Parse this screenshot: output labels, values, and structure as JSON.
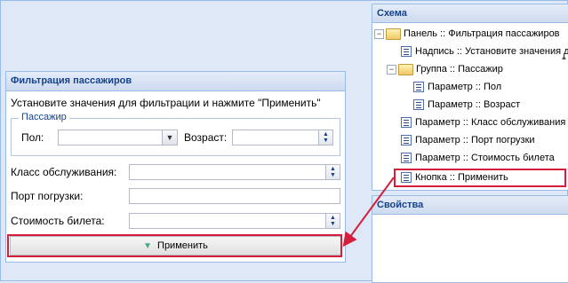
{
  "filter_panel": {
    "title": "Фильтрация пассажиров",
    "instruction": "Установите значения для фильтрации и нажмите \"Применить\"",
    "passenger_group": {
      "legend": "Пассажир",
      "gender_label": "Пол:",
      "gender_value": "",
      "age_label": "Возраст:",
      "age_value": ""
    },
    "class_label": "Класс обслуживания:",
    "class_value": "",
    "port_label": "Порт погрузки:",
    "port_value": "",
    "price_label": "Стоимость билета:",
    "price_value": "",
    "apply_label": "Применить"
  },
  "schema_panel": {
    "title": "Схема",
    "nodes": [
      "Панель :: Фильтрация пассажиров",
      "Надпись :: Установите значения д",
      "Группа :: Пассажир",
      "Параметр :: Пол",
      "Параметр :: Возраст",
      "Параметр :: Класс обслуживания",
      "Параметр :: Порт погрузки",
      "Параметр :: Стоимость билета",
      "Кнопка :: Применить"
    ]
  },
  "properties_panel": {
    "title": "Свойства"
  },
  "colors": {
    "highlight": "#d41f3c",
    "header_text": "#15428b",
    "accent": "#4aa882"
  },
  "icons": [
    "combo-arrow-icon",
    "spinner-icon",
    "folder-icon",
    "leaf-icon",
    "expander-icon",
    "apply-triangle-icon"
  ]
}
